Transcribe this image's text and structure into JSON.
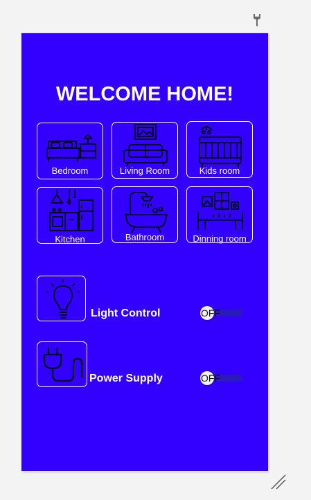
{
  "screen": {
    "title": "WELCOME HOME!",
    "background": "#3300ff"
  },
  "rooms": [
    {
      "label": "Bedroom",
      "icon": "bed-icon"
    },
    {
      "label": "Living Room",
      "icon": "sofa-icon"
    },
    {
      "label": "Kids room",
      "icon": "crib-icon"
    },
    {
      "label": "Kitchen",
      "icon": "kitchen-icon"
    },
    {
      "label": "Bathroom",
      "icon": "bathtub-icon"
    },
    {
      "label": "Dinning room",
      "icon": "dining-table-icon"
    }
  ],
  "controls": {
    "light": {
      "label": "Light Control",
      "state": "OFF",
      "icon": "light-bulb-icon"
    },
    "power": {
      "label": "Power Supply",
      "state": "OFF",
      "icon": "power-plug-icon"
    }
  },
  "window": {
    "settings_icon": "wrench-icon",
    "resize_icon": "resize-grip-icon"
  }
}
